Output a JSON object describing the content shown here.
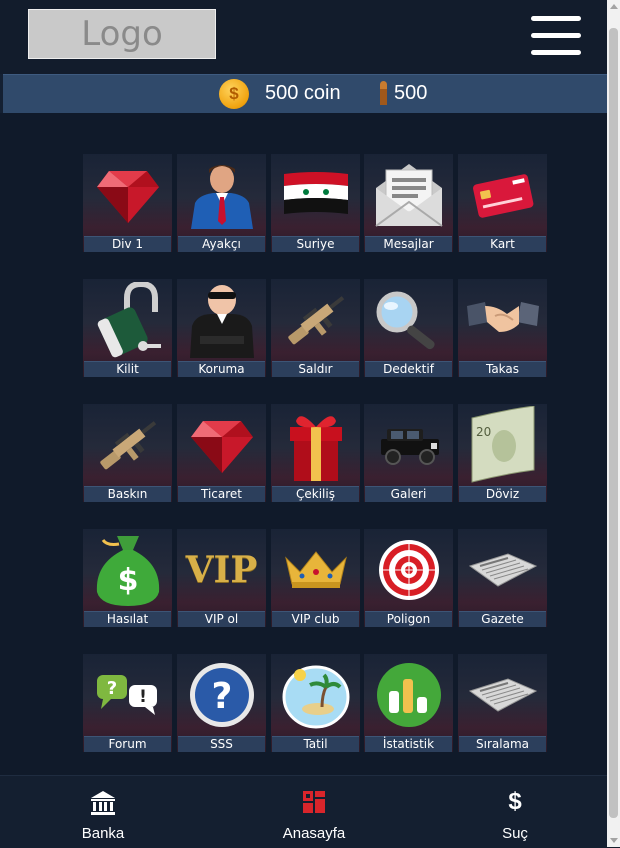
{
  "header": {
    "logo_text": "Logo",
    "menu_icon": "hamburger-menu-icon"
  },
  "status": {
    "coin_symbol": "$",
    "coin_text": "500 coin",
    "bullet_text": "500"
  },
  "grid": [
    {
      "label": "Div 1",
      "icon": "ruby-gem-icon"
    },
    {
      "label": "Ayakçı",
      "icon": "businessman-icon"
    },
    {
      "label": "Suriye",
      "icon": "syria-flag-icon"
    },
    {
      "label": "Mesajlar",
      "icon": "envelope-icon"
    },
    {
      "label": "Kart",
      "icon": "credit-card-icon"
    },
    {
      "label": "Kilit",
      "icon": "padlock-icon"
    },
    {
      "label": "Koruma",
      "icon": "bodyguard-icon"
    },
    {
      "label": "Saldır",
      "icon": "rifle-icon"
    },
    {
      "label": "Dedektif",
      "icon": "magnifier-icon"
    },
    {
      "label": "Takas",
      "icon": "handshake-icon"
    },
    {
      "label": "Baskın",
      "icon": "rifle-icon"
    },
    {
      "label": "Ticaret",
      "icon": "ruby-gem-icon"
    },
    {
      "label": "Çekiliş",
      "icon": "gift-box-icon"
    },
    {
      "label": "Galeri",
      "icon": "jeep-icon"
    },
    {
      "label": "Döviz",
      "icon": "banknote-icon"
    },
    {
      "label": "Hasılat",
      "icon": "money-bag-icon"
    },
    {
      "label": "VIP ol",
      "icon": "vip-text-icon"
    },
    {
      "label": "VIP club",
      "icon": "crown-icon"
    },
    {
      "label": "Poligon",
      "icon": "target-icon"
    },
    {
      "label": "Gazete",
      "icon": "newspaper-icon"
    },
    {
      "label": "Forum",
      "icon": "chat-bubbles-icon"
    },
    {
      "label": "SSS",
      "icon": "question-icon"
    },
    {
      "label": "Tatil",
      "icon": "island-icon"
    },
    {
      "label": "İstatistik",
      "icon": "bar-stats-icon"
    },
    {
      "label": "Sıralama",
      "icon": "newspaper-icon"
    }
  ],
  "vip_art_text": "VIP",
  "nav": {
    "bank": {
      "label": "Banka",
      "icon": "bank-icon"
    },
    "home": {
      "label": "Anasayfa",
      "icon": "home-grid-icon"
    },
    "crime": {
      "label": "Suç",
      "icon": "dollar-icon",
      "symbol": "$"
    }
  },
  "colors": {
    "background": "#142032",
    "status_bar": "#304a6b",
    "caption": "#2c3f5c",
    "coin": "#f0a20e",
    "home_icon": "#d9252b"
  }
}
